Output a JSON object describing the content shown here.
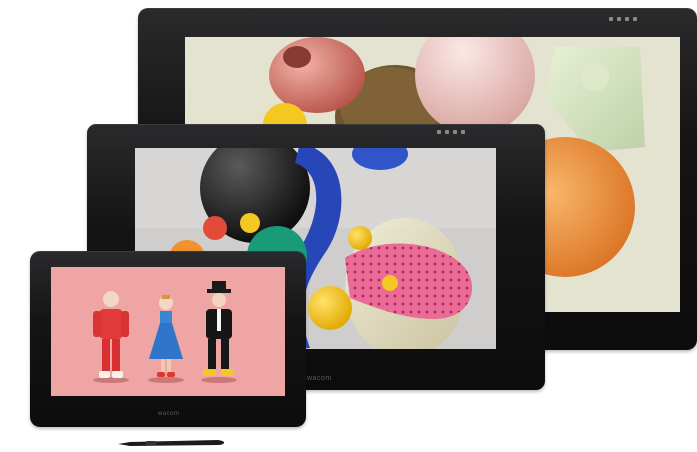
{
  "devices": {
    "large": {
      "brand": ""
    },
    "medium": {
      "brand": "wacom"
    },
    "small": {
      "brand": "wacom"
    }
  },
  "colors": {
    "bezel": "#111112",
    "large_screen_bg": "#e4e3d0",
    "medium_screen_bg": "#c9c8c6",
    "small_screen_bg": "#eea5a4",
    "pink": "#e9648f",
    "yellow": "#f5c721",
    "blue": "#2f55c8",
    "teal": "#1a9b78",
    "orange": "#f0922d",
    "red_figure": "#e03a3a"
  },
  "icons": [
    "express-key-icons",
    "pen-icon"
  ]
}
